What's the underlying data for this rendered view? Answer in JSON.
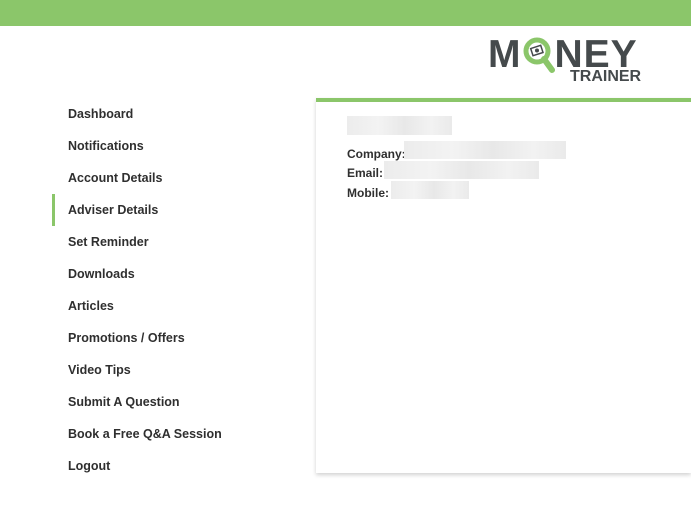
{
  "brand": {
    "logo_word": "MONEY",
    "logo_sub": "TRAINER",
    "accent_color": "#8bc66a",
    "logo_text_color": "#454a4c"
  },
  "sidebar": {
    "items": [
      {
        "label": "Dashboard"
      },
      {
        "label": "Notifications"
      },
      {
        "label": "Account Details"
      },
      {
        "label": "Adviser Details",
        "active": true
      },
      {
        "label": "Set Reminder"
      },
      {
        "label": "Downloads"
      },
      {
        "label": "Articles"
      },
      {
        "label": "Promotions / Offers"
      },
      {
        "label": "Video Tips"
      },
      {
        "label": "Submit A Question"
      },
      {
        "label": "Book a Free Q&A Session"
      },
      {
        "label": "Logout"
      }
    ]
  },
  "adviser": {
    "company_label": "Company:",
    "email_label": "Email:",
    "mobile_label": "Mobile:"
  }
}
